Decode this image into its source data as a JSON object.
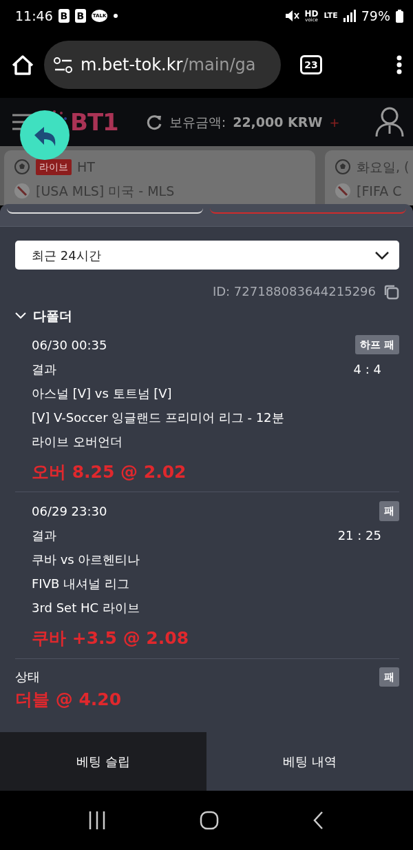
{
  "status_bar": {
    "time": "11:46",
    "notification_letters": [
      "B",
      "B"
    ],
    "chat_label": "TALK",
    "hd_label": "HD",
    "voice_label": "voice",
    "network_label": "LTE",
    "battery": "79%"
  },
  "browser": {
    "url_host": "m.bet-tok.kr",
    "url_path": "/main/ga",
    "tab_count": "23"
  },
  "app_header": {
    "logo": "BT1",
    "balance_label": "보유금액:",
    "balance": "22,000 KRW",
    "plus": "+"
  },
  "match_cards": [
    {
      "badge": "라이브",
      "status": "HT",
      "league": "[USA MLS] 미국 - MLS"
    },
    {
      "status": "화요일, (",
      "league": "[FIFA C"
    }
  ],
  "sheet_tabs": [
    {
      "selected": false
    },
    {
      "selected": true
    }
  ],
  "filter": {
    "value": "최근 24시간"
  },
  "bet": {
    "id": "ID: 727188083644215296",
    "group": {
      "title": "다폴더",
      "expanded": true
    },
    "legs": [
      {
        "datetime": "06/30 00:35",
        "market": "결과",
        "score": "4 : 4",
        "match": "아스널 [V] vs 토트넘 [V]",
        "league": "[V] V-Soccer 잉글랜드 프리미어 리그 - 12분",
        "bet_type": "라이브 오버언더",
        "pick": "오버 8.25 @ 2.02",
        "result": "하프 패"
      },
      {
        "datetime": "06/29 23:30",
        "market": "결과",
        "score": "21 : 25",
        "match": "쿠바 vs 아르헨티나",
        "league": "FIVB 내셔널 리그",
        "bet_type": "3rd Set HC 라이브",
        "pick": "쿠바 +3.5 @ 2.08",
        "result": "패"
      }
    ],
    "status_label": "상태",
    "status_result": "패",
    "total_pick": "더블 @ 4.20"
  },
  "bottom_tabs": [
    {
      "label": "베팅 슬립",
      "selected": true
    },
    {
      "label": "베팅 내역",
      "selected": false
    }
  ]
}
